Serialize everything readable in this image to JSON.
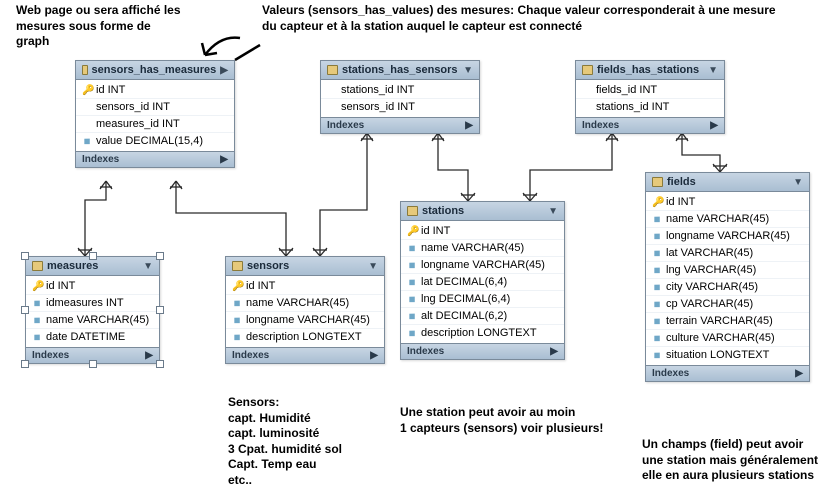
{
  "annotations": {
    "web_page": "Web page ou sera affiché les\nmesures sous forme de\ngraph",
    "values": "Valeurs  (sensors_has_values) des mesures: Chaque valeur corresponderait à une mesure\ndu capteur et à la station auquel  le capteur est connecté",
    "sensors_note": "Sensors:\ncapt. Humidité\ncapt. luminosité\n3 Cpat. humidité sol\nCapt. Temp eau\netc..",
    "station_note": "Une station peut avoir au moin\n1 capteurs (sensors) voir plusieurs!",
    "fields_note": "Un champs (field) peut avoir\nune station mais généralement\nelle en aura plusieurs stations"
  },
  "tables": {
    "sensors_has_measures": {
      "title": "sensors_has_measures",
      "cols": [
        {
          "icon": "key",
          "label": "id INT"
        },
        {
          "icon": "",
          "label": "sensors_id INT"
        },
        {
          "icon": "",
          "label": "measures_id INT"
        },
        {
          "icon": "dia",
          "label": "value DECIMAL(15,4)"
        }
      ],
      "indexes": "Indexes"
    },
    "stations_has_sensors": {
      "title": "stations_has_sensors",
      "cols": [
        {
          "icon": "",
          "label": "stations_id INT"
        },
        {
          "icon": "",
          "label": "sensors_id INT"
        }
      ],
      "indexes": "Indexes"
    },
    "fields_has_stations": {
      "title": "fields_has_stations",
      "cols": [
        {
          "icon": "",
          "label": "fields_id INT"
        },
        {
          "icon": "",
          "label": "stations_id INT"
        }
      ],
      "indexes": "Indexes"
    },
    "measures": {
      "title": "measures",
      "cols": [
        {
          "icon": "key",
          "label": "id INT"
        },
        {
          "icon": "dia",
          "label": "idmeasures INT"
        },
        {
          "icon": "dia",
          "label": "name VARCHAR(45)"
        },
        {
          "icon": "dia",
          "label": "date DATETIME"
        }
      ],
      "indexes": "Indexes"
    },
    "sensors": {
      "title": "sensors",
      "cols": [
        {
          "icon": "key",
          "label": "id INT"
        },
        {
          "icon": "dia",
          "label": "name VARCHAR(45)"
        },
        {
          "icon": "dia",
          "label": "longname VARCHAR(45)"
        },
        {
          "icon": "dia",
          "label": "description LONGTEXT"
        }
      ],
      "indexes": "Indexes"
    },
    "stations": {
      "title": "stations",
      "cols": [
        {
          "icon": "key",
          "label": "id INT"
        },
        {
          "icon": "dia",
          "label": "name VARCHAR(45)"
        },
        {
          "icon": "dia",
          "label": "longname VARCHAR(45)"
        },
        {
          "icon": "dia",
          "label": "lat DECIMAL(6,4)"
        },
        {
          "icon": "dia",
          "label": "lng DECIMAL(6,4)"
        },
        {
          "icon": "dia",
          "label": "alt DECIMAL(6,2)"
        },
        {
          "icon": "dia",
          "label": "description LONGTEXT"
        }
      ],
      "indexes": "Indexes"
    },
    "fields": {
      "title": "fields",
      "cols": [
        {
          "icon": "key",
          "label": "id INT"
        },
        {
          "icon": "dia",
          "label": "name VARCHAR(45)"
        },
        {
          "icon": "dia",
          "label": "longname VARCHAR(45)"
        },
        {
          "icon": "dia",
          "label": "lat VARCHAR(45)"
        },
        {
          "icon": "dia",
          "label": "lng VARCHAR(45)"
        },
        {
          "icon": "dia",
          "label": "city VARCHAR(45)"
        },
        {
          "icon": "dia",
          "label": "cp VARCHAR(45)"
        },
        {
          "icon": "dia",
          "label": "terrain VARCHAR(45)"
        },
        {
          "icon": "dia",
          "label": "culture VARCHAR(45)"
        },
        {
          "icon": "dia",
          "label": "situation LONGTEXT"
        }
      ],
      "indexes": "Indexes"
    }
  }
}
